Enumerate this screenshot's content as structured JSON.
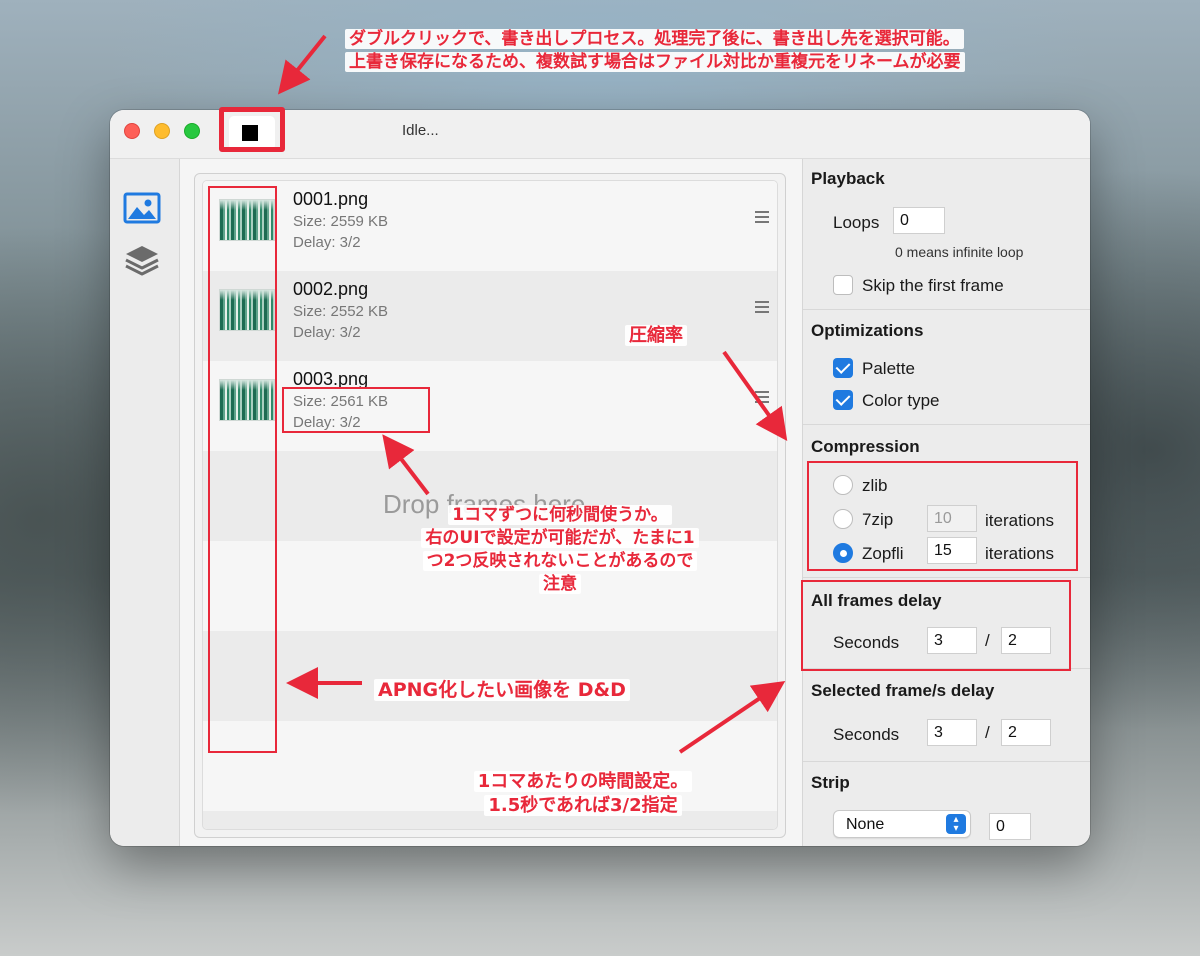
{
  "window": {
    "status": "Idle..."
  },
  "sidebar": {
    "items": [
      {
        "icon": "image-icon",
        "active": true
      },
      {
        "icon": "layers-icon",
        "active": false
      }
    ]
  },
  "frames": [
    {
      "name": "0001.png",
      "size": "Size: 2559 KB",
      "delay": "Delay: 3/2"
    },
    {
      "name": "0002.png",
      "size": "Size: 2552 KB",
      "delay": "Delay: 3/2"
    },
    {
      "name": "0003.png",
      "size": "Size: 2561 KB",
      "delay": "Delay: 3/2"
    }
  ],
  "drop_hint": "Drop frames here",
  "panel": {
    "playback": {
      "title": "Playback",
      "loops_label": "Loops",
      "loops_value": "0",
      "loops_hint": "0 means infinite loop",
      "skip_first_label": "Skip the first frame",
      "skip_first_checked": false
    },
    "optimizations": {
      "title": "Optimizations",
      "palette_label": "Palette",
      "palette_checked": true,
      "color_type_label": "Color type",
      "color_type_checked": true
    },
    "compression": {
      "title": "Compression",
      "options": [
        {
          "label": "zlib",
          "selected": false
        },
        {
          "label": "7zip",
          "selected": false,
          "iterations": "10",
          "iterations_label": "iterations"
        },
        {
          "label": "Zopfli",
          "selected": true,
          "iterations": "15",
          "iterations_label": "iterations"
        }
      ]
    },
    "all_frames_delay": {
      "title": "All frames delay",
      "seconds_label": "Seconds",
      "numerator": "3",
      "separator": "/",
      "denominator": "2"
    },
    "selected_frames_delay": {
      "title": "Selected frame/s delay",
      "seconds_label": "Seconds",
      "numerator": "3",
      "separator": "/",
      "denominator": "2"
    },
    "strip": {
      "title": "Strip",
      "selected": "None",
      "value": "0"
    }
  },
  "annotations": {
    "export_line1": "ダブルクリックで、書き出しプロセス。処理完了後に、書き出し先を選択可能。",
    "export_line2": "上書き保存になるため、複数試す場合はファイル対比か重複元をリネームが必要",
    "compression_rate": "圧縮率",
    "delay_line1": "1コマずつに何秒間使うか。",
    "delay_line2": "右のUIで設定が可能だが、たまに1",
    "delay_line3": "つ2つ反映されないことがあるので",
    "delay_line4": "注意",
    "dnd": "APNG化したい画像を D&D",
    "time_line1": "1コマあたりの時間設定。",
    "time_line2": "1.5秒であれば3/2指定"
  },
  "colors": {
    "accent": "#1f7ae0",
    "annotation": "#e8283a"
  }
}
